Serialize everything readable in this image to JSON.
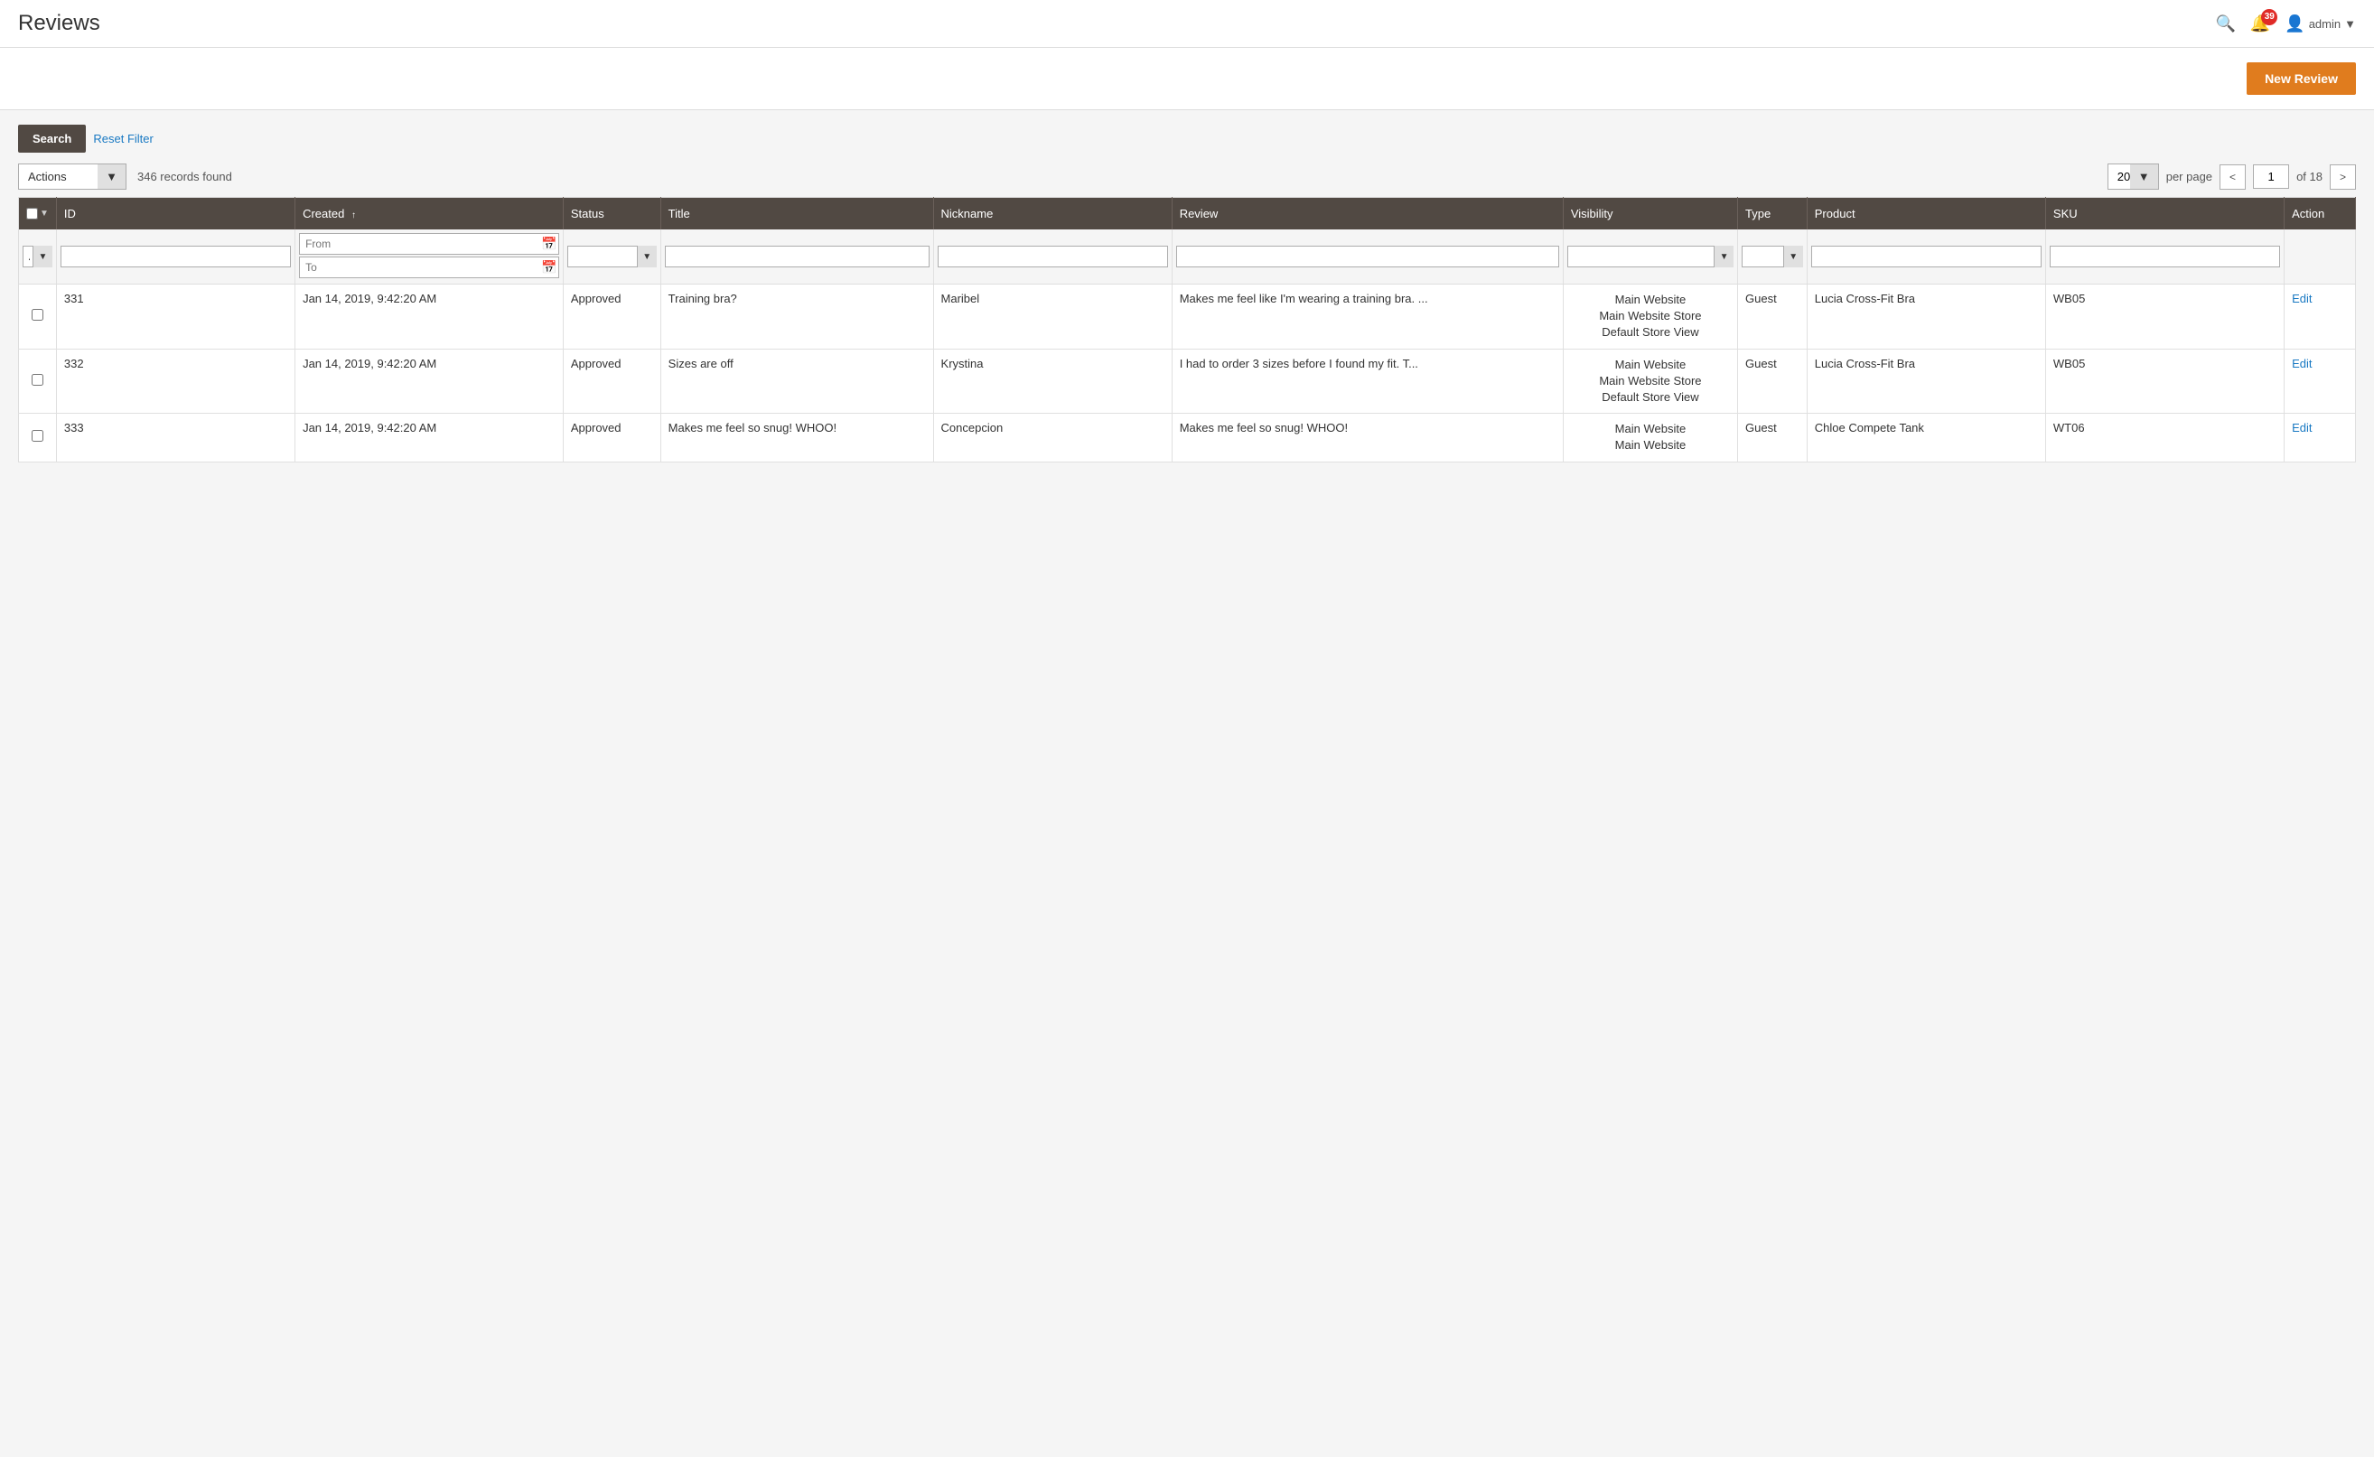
{
  "header": {
    "title": "Reviews",
    "bell_count": "39",
    "admin_label": "admin",
    "search_label": "Search"
  },
  "toolbar": {
    "new_review_label": "New Review"
  },
  "filters": {
    "search_label": "Search",
    "reset_filter_label": "Reset Filter"
  },
  "table_controls": {
    "actions_label": "Actions",
    "records_found": "346 records found",
    "per_page_value": "20",
    "per_page_label": "per page",
    "page_current": "1",
    "page_total": "of 18"
  },
  "columns": {
    "id": "ID",
    "created": "Created",
    "status": "Status",
    "title": "Title",
    "nickname": "Nickname",
    "review": "Review",
    "visibility": "Visibility",
    "type": "Type",
    "product": "Product",
    "sku": "SKU",
    "action": "Action"
  },
  "filter_placeholders": {
    "from": "From",
    "to": "To"
  },
  "rows": [
    {
      "id": "331",
      "created": "Jan 14, 2019, 9:42:20 AM",
      "status": "Approved",
      "title": "Training bra?",
      "nickname": "Maribel",
      "review": "Makes me feel like I'm wearing a training bra. ...",
      "visibility": "Main Website\nMain Website Store\nDefault Store View",
      "type": "Guest",
      "product": "Lucia Cross-Fit Bra",
      "sku": "WB05",
      "action": "Edit"
    },
    {
      "id": "332",
      "created": "Jan 14, 2019, 9:42:20 AM",
      "status": "Approved",
      "title": "Sizes are off",
      "nickname": "Krystina",
      "review": "I had to order 3 sizes before I found my fit. T...",
      "visibility": "Main Website\nMain Website Store\nDefault Store View",
      "type": "Guest",
      "product": "Lucia Cross-Fit Bra",
      "sku": "WB05",
      "action": "Edit"
    },
    {
      "id": "333",
      "created": "Jan 14, 2019, 9:42:20 AM",
      "status": "Approved",
      "title": "Makes me feel so snug! WHOO!",
      "nickname": "Concepcion",
      "review": "Makes me feel so snug! WHOO!",
      "visibility": "Main Website\nMain Website",
      "type": "Guest",
      "product": "Chloe Compete Tank",
      "sku": "WT06",
      "action": "Edit"
    }
  ]
}
